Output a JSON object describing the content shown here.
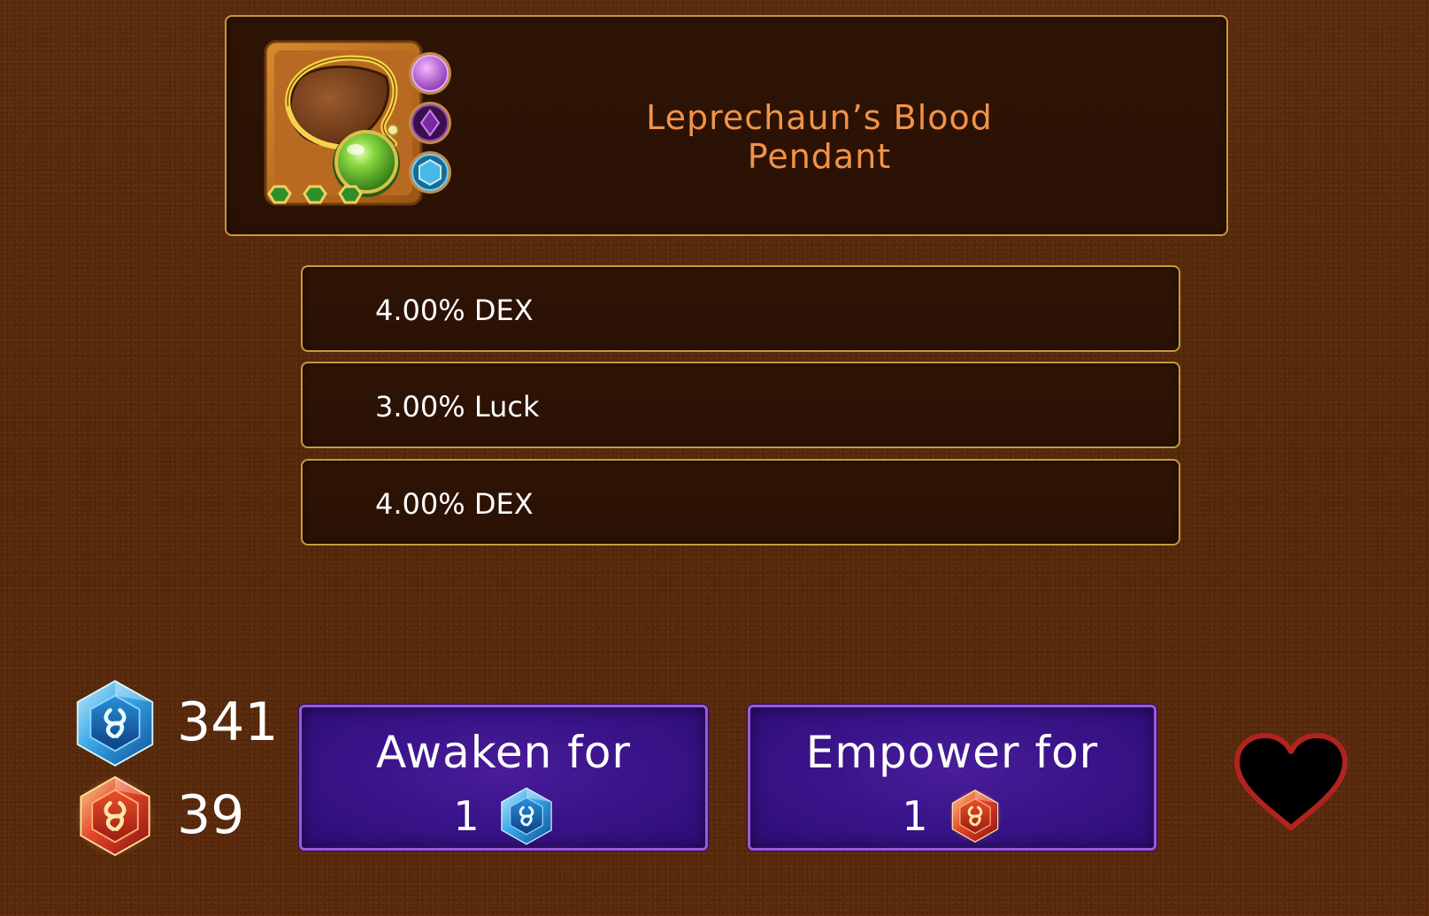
{
  "item": {
    "name": "Leprechaun’s Blood Pendant",
    "icon": "pendant-icon",
    "sockets": [
      "purple-orb-gem-icon",
      "purple-diamond-gem-icon",
      "blue-crystal-gem-icon"
    ],
    "stars": [
      "green-star-icon",
      "green-star-icon",
      "green-star-icon"
    ]
  },
  "stats": [
    {
      "text": "4.00% DEX"
    },
    {
      "text": "3.00% Luck"
    },
    {
      "text": "4.00% DEX"
    }
  ],
  "currency": {
    "blue": {
      "icon": "blue-awaken-crystal-icon",
      "count": "341"
    },
    "red": {
      "icon": "red-empower-crystal-icon",
      "count": "39"
    }
  },
  "actions": {
    "awaken": {
      "label": "Awaken for",
      "cost": "1",
      "cost_icon": "blue-awaken-crystal-icon"
    },
    "empower": {
      "label": "Empower for",
      "cost": "1",
      "cost_icon": "red-empower-crystal-icon"
    }
  },
  "favorite": {
    "icon": "heart-icon"
  },
  "colors": {
    "background": "#5a2a0d",
    "panel": "#2f1405",
    "panel_border": "#c79a3a",
    "item_name": "#f0934a",
    "button": "#3a148a",
    "button_border": "#9b5ad8",
    "heart_fill": "#000000",
    "heart_outline": "#b0231f"
  }
}
